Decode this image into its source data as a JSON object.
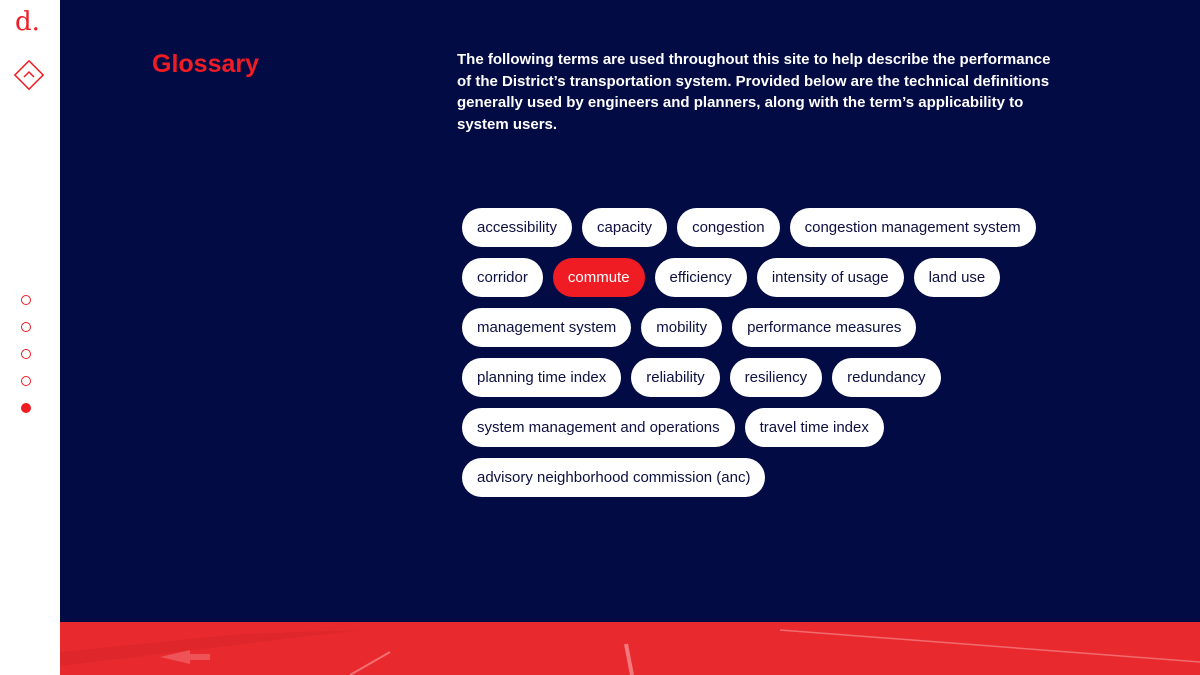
{
  "sidebar": {
    "logo_text": "d.",
    "up_icon": "chevron-up-diamond-icon",
    "nav_dots": [
      {
        "active": false
      },
      {
        "active": false
      },
      {
        "active": false
      },
      {
        "active": false
      },
      {
        "active": true
      }
    ]
  },
  "main": {
    "title": "Glossary",
    "intro": "The following terms are used throughout this site to help describe the performance of the District’s transportation system. Provided below are the technical definitions generally used by engineers and planners, along with the term’s applicability to system users.",
    "terms": [
      "accessibility",
      "capacity",
      "congestion",
      "congestion management system",
      "corridor",
      "commute",
      "efficiency",
      "intensity of usage",
      "land use",
      "management system",
      "mobility",
      "performance measures",
      "planning time index",
      "reliability",
      "resiliency",
      "redundancy",
      "system management and operations",
      "travel time index",
      "advisory neighborhood commission (anc)"
    ],
    "active_term": "commute"
  },
  "colors": {
    "accent": "#ef1c24",
    "background": "#030b45",
    "tag_bg": "#ffffff",
    "tag_text": "#0d1040"
  }
}
